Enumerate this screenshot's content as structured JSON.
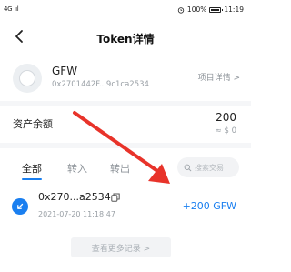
{
  "status_bar": {
    "signal": "4G .ıl",
    "battery_percent": "100%",
    "time": "11:19",
    "icons": [
      "alarm-icon",
      "battery-icon"
    ]
  },
  "header": {
    "title": "Token详情",
    "back_icon": "chevron-left-icon"
  },
  "token": {
    "name": "GFW",
    "address": "0x2701442F...9c1ca2534",
    "details_link": "项目详情 >"
  },
  "balance": {
    "label": "资产余额",
    "amount": "200",
    "fiat": "≈ $ 0"
  },
  "tabs": [
    {
      "label": "全部",
      "active": true
    },
    {
      "label": "转入",
      "active": false
    },
    {
      "label": "转出",
      "active": false
    }
  ],
  "search": {
    "placeholder": "搜索交易"
  },
  "transactions": [
    {
      "hash": "0x270...a2534",
      "time": "2021-07-20 11:18:47",
      "amount": "+200 GFW"
    }
  ],
  "more_button": {
    "label": "查看更多记录 >"
  },
  "colors": {
    "accent": "#1a7ff0",
    "annotation_arrow": "#e8332a"
  }
}
